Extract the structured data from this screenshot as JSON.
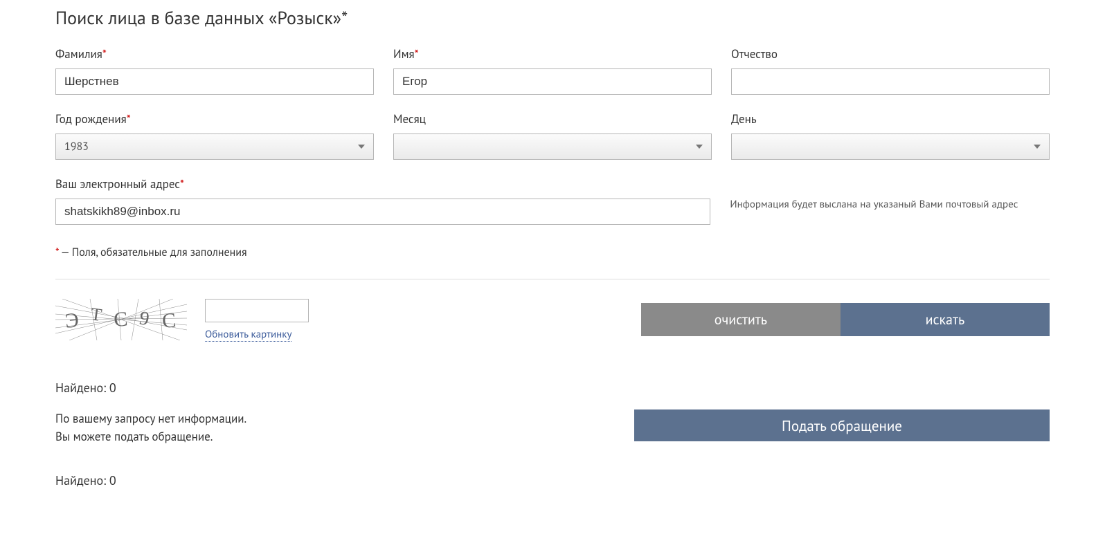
{
  "title": "Поиск лица в базе данных «Розыск»*",
  "labels": {
    "surname": "Фамилия",
    "name": "Имя",
    "patronymic": "Отчество",
    "birth_year": "Год рождения",
    "month": "Месяц",
    "day": "День",
    "email": "Ваш электронный адрес"
  },
  "values": {
    "surname": "Шерстнев",
    "name": "Егор",
    "patronymic": "",
    "birth_year": "1983",
    "month": "",
    "day": "",
    "email": "shatskikh89@inbox.ru"
  },
  "email_note": "Информация будет выслана на указаный Вами почтовый адрес",
  "required_note_prefix": "*",
  "required_note": " — Поля, обязательные для заполнения",
  "captcha": {
    "refresh": "Обновить картинку"
  },
  "buttons": {
    "clear": "очистить",
    "search": "искать",
    "submit_request": "Подать обращение"
  },
  "results": {
    "found_label_1": "Найдено: 0",
    "no_info_line1": "По вашему запросу нет информации.",
    "no_info_line2": "Вы можете подать обращение.",
    "found_label_2": "Найдено: 0"
  }
}
